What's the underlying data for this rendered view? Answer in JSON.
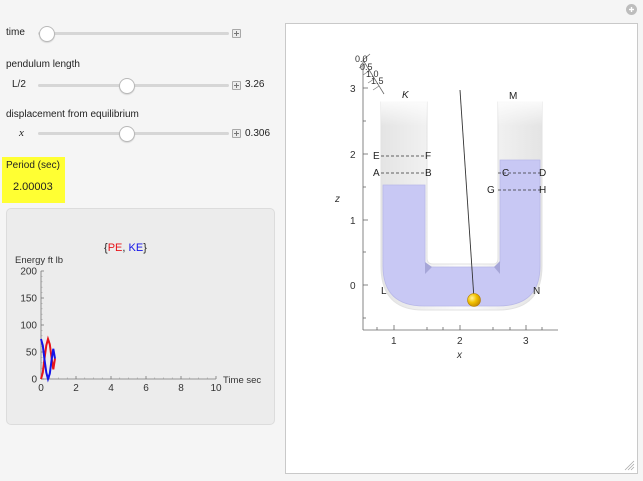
{
  "controls": {
    "time": {
      "label": "time",
      "value": 0.04
    },
    "pendulum_length": {
      "label": "pendulum length",
      "prefix": "L/2",
      "value_text": "3.26",
      "value": 0.46
    },
    "displacement": {
      "label": "displacement from equilibrium",
      "prefix": "x",
      "value_text": "0.306",
      "value": 0.46
    }
  },
  "period": {
    "label": "Period (sec)",
    "value": "2.00003"
  },
  "energy_plot": {
    "title_open": "{",
    "title_pe": "PE",
    "title_sep": ", ",
    "title_ke": "KE",
    "title_close": "}",
    "ylabel": "Energy ft lb",
    "xlabel": "Time sec",
    "pe_color": "#e8141a",
    "ke_color": "#1414e8",
    "chart_data": {
      "type": "line",
      "xlim": [
        0,
        10
      ],
      "ylim": [
        0,
        200
      ],
      "xticks": [
        0,
        2,
        4,
        6,
        8,
        10
      ],
      "yticks": [
        0,
        50,
        100,
        150,
        200
      ],
      "series": [
        {
          "name": "PE",
          "x": [
            0,
            0.1,
            0.2,
            0.3,
            0.4,
            0.5,
            0.6,
            0.7,
            0.8
          ],
          "y": [
            0,
            12,
            38,
            62,
            74,
            64,
            40,
            18,
            38
          ]
        },
        {
          "name": "KE",
          "x": [
            0,
            0.1,
            0.2,
            0.3,
            0.4,
            0.5,
            0.6,
            0.7,
            0.8
          ],
          "y": [
            74,
            62,
            36,
            12,
            0,
            10,
            34,
            56,
            38
          ]
        }
      ]
    }
  },
  "view3d": {
    "zlabel": "z",
    "xlabel": "x",
    "z_ticks": [
      "3",
      "2",
      "1",
      "0"
    ],
    "x_ticks": [
      "1",
      "2",
      "3"
    ],
    "depth_ticks": [
      "0.0",
      "0.5",
      "1.0",
      "1.5"
    ],
    "labels": {
      "K": "K",
      "M": "M",
      "L": "L",
      "N": "N",
      "E": "E",
      "F": "F",
      "A": "A",
      "B": "B",
      "C": "C",
      "D": "D",
      "G": "G",
      "H": "H"
    },
    "liquid_color": "#c8c8f4",
    "bob_color": "#f2c200"
  }
}
